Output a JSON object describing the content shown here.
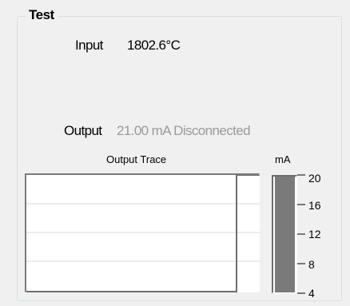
{
  "group": {
    "title": "Test"
  },
  "input": {
    "label": "Input",
    "value": "1802.6°C"
  },
  "output": {
    "label": "Output",
    "value": "21.00 mA Disconnected",
    "value_color": "#9a9a9a"
  },
  "trace": {
    "title": "Output Trace",
    "gridline_color": "#d9d9d9",
    "trace_color": "#6e6e6e"
  },
  "meter": {
    "unit": "mA",
    "scale_min": 4,
    "scale_max": 20,
    "ticks": [
      "20",
      "16",
      "12",
      "8",
      "4"
    ],
    "fill_fraction": 1.0,
    "fill_color": "#7a7a7a"
  }
}
